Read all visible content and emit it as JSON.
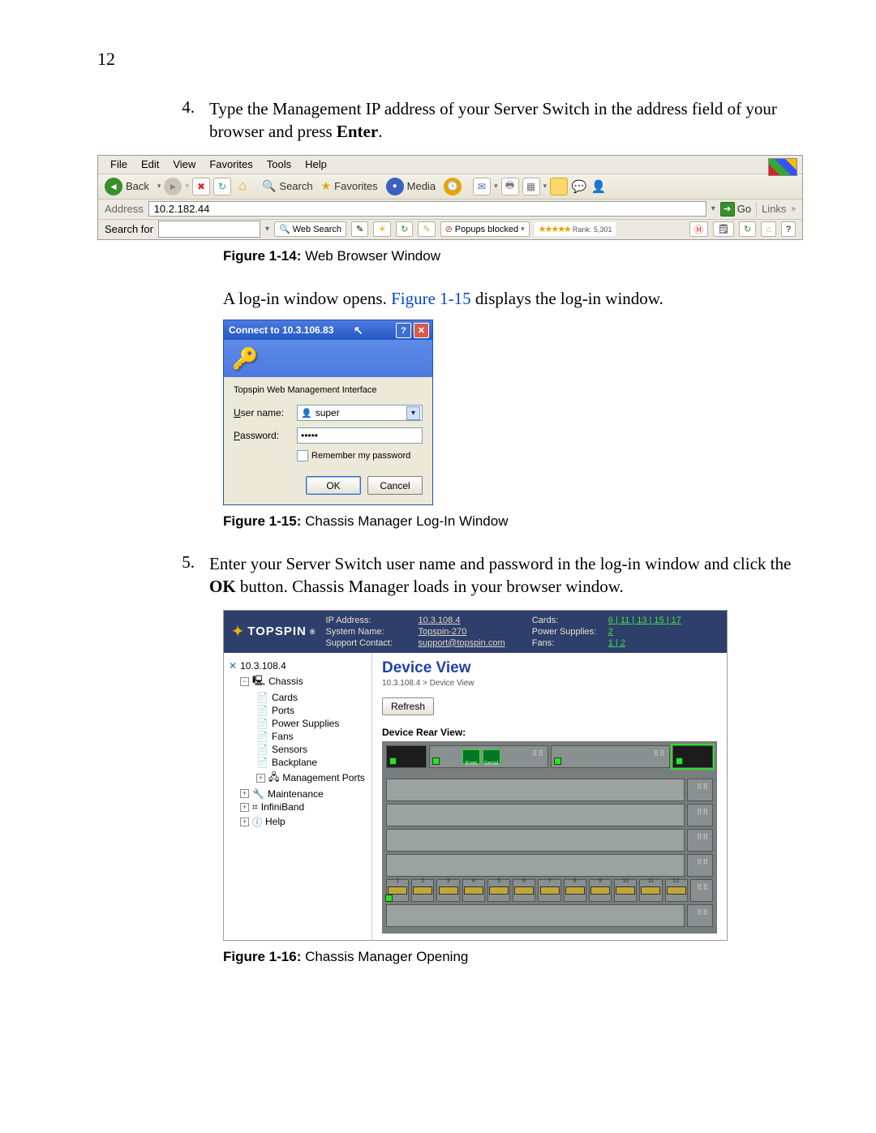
{
  "page_number": "12",
  "step4": {
    "num": "4.",
    "text_a": "Type the Management IP address of your Server Switch in the address field of your browser and press ",
    "text_b": "Enter",
    "text_c": "."
  },
  "browser": {
    "menu": {
      "file": "File",
      "edit": "Edit",
      "view": "View",
      "favorites": "Favorites",
      "tools": "Tools",
      "help": "Help"
    },
    "back": "Back",
    "search": "Search",
    "favorites": "Favorites",
    "media": "Media",
    "address_label": "Address",
    "address_value": "10.2.182.44",
    "go": "Go",
    "links": "Links",
    "searchfor_label": "Search for",
    "websearch": "Web Search",
    "popups": "Popups blocked",
    "rank": "Rank: 5,301"
  },
  "caption14_a": "Figure 1-14: ",
  "caption14_b": "Web Browser Window",
  "para_login_a": "A log-in window opens.",
  "para_login_ref": " Figure 1-15 ",
  "para_login_b": "displays the log-in window.",
  "login": {
    "title": "Connect to 10.3.106.83",
    "iface": "Topspin Web Management Interface",
    "username_u": "U",
    "username_r": "ser name:",
    "password_u": "P",
    "password_r": "assword:",
    "user_value": "super",
    "pass_value": "•••••",
    "remember_u": "R",
    "remember_r": "emember my password",
    "ok": "OK",
    "cancel": "Cancel"
  },
  "caption15_a": "Figure 1-15: ",
  "caption15_b": "Chassis Manager Log-In Window",
  "step5": {
    "num": "5.",
    "text_a": "Enter your Server Switch user name and password in the log-in window and click the ",
    "text_b": "OK",
    "text_c": " button. Chassis Manager loads in your browser window."
  },
  "cm": {
    "brand": "TOPSPIN",
    "ip_label": "IP Address:",
    "ip_value": "10.3.108.4",
    "sys_label": "System Name:",
    "sys_value": "Topspin-270",
    "sup_label": "Support Contact:",
    "sup_value": "support@topspin.com",
    "cards_label": "Cards:",
    "cards_value": "6 | 11 | 13 | 15 | 17",
    "ps_label": "Power Supplies:",
    "ps_value": "2",
    "fans_label": "Fans:",
    "fans_value": "1 | 2",
    "tree": {
      "root": "10.3.108.4",
      "chassis": "Chassis",
      "cards": "Cards",
      "ports": "Ports",
      "powersupplies": "Power Supplies",
      "fans": "Fans",
      "sensors": "Sensors",
      "backplane": "Backplane",
      "mports": "Management Ports",
      "maintenance": "Maintenance",
      "infiniband": "InfiniBand",
      "help": "Help"
    },
    "title": "Device View",
    "breadcrumb": "10.3.108.4 > Device View",
    "refresh": "Refresh",
    "rear_label": "Device Rear View:",
    "port_enet": "Enet",
    "port_serial": "Serial"
  },
  "caption16_a": "Figure 1-16: ",
  "caption16_b": "Chassis Manager Opening"
}
